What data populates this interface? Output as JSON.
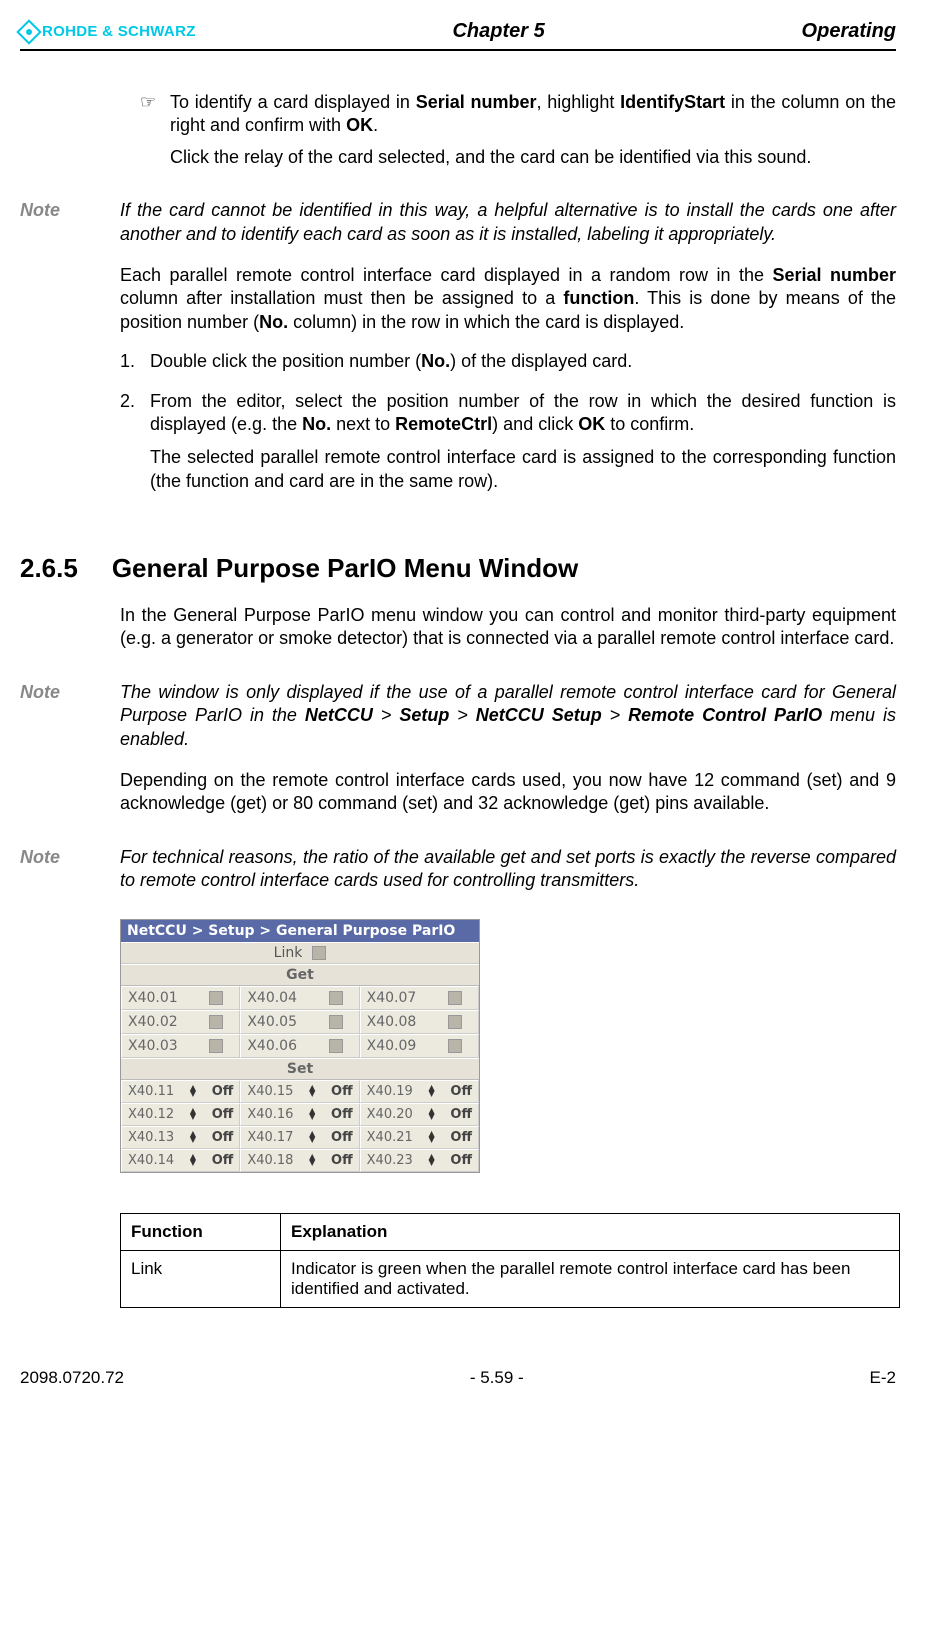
{
  "header": {
    "brand": "ROHDE & SCHWARZ",
    "chapter": "Chapter 5",
    "operating": "Operating"
  },
  "intro": {
    "bullet_pre": "To identify a card displayed in ",
    "serial_number": "Serial number",
    "bullet_mid": ", highlight ",
    "identify_start": "IdentifyStart",
    "bullet_post1": " in the column on the right and confirm with ",
    "ok": "OK",
    "bullet_end": ".",
    "sub": "Click the relay of the card selected, and the card can be identified via this sound."
  },
  "note1": {
    "label": "Note",
    "text": "If the card cannot be identified in this way, a helpful alternative is to install the cards one after another and to identify each card as soon as it is installed, labeling it appropriately."
  },
  "para1": {
    "pre": "Each parallel remote control interface card displayed in a random row in the ",
    "serial": "Serial number",
    "mid1": " column after installation must then be assigned to a ",
    "func": "function",
    "mid2": ". This is done by means of the position number (",
    "no": "No.",
    "end": " column) in the row in which the card is displayed."
  },
  "step1": {
    "num": "1.",
    "pre": "Double click the position number (",
    "no": "No.",
    "end": ") of the displayed card."
  },
  "step2": {
    "num": "2.",
    "pre": "From the editor, select the position number of the row in which the desired function is displayed (e.g. the ",
    "no": "No.",
    "mid": " next to ",
    "rc": "RemoteCtrl",
    "mid2": ") and click ",
    "ok": "OK",
    "end": " to confirm.",
    "sub": "The selected parallel remote control interface card is assigned to the corresponding function (the function and card are in the same row)."
  },
  "h2": {
    "num": "2.6.5",
    "title": "General Purpose ParIO Menu Window"
  },
  "para2": "In the General Purpose ParIO menu window you can control and monitor third-party equipment (e.g. a generator or smoke detector) that is connected via a parallel remote control interface card.",
  "note2": {
    "label": "Note",
    "pre": "The window is only displayed if the use of a parallel remote control interface card for General Purpose ParIO in the ",
    "path1": "NetCCU",
    "gt": " > ",
    "path2": "Setup",
    "path3": "NetCCU Setup",
    "path4": "Remote Control ParIO",
    "end": " menu is enabled."
  },
  "para3": "Depending on the remote control interface cards used, you now have 12 command (set) and 9 acknowledge (get) or 80 command (set) and 32 acknowledge (get) pins available.",
  "note3": {
    "label": "Note",
    "text": "For technical reasons, the ratio of the available get and set ports is exactly the reverse compared to remote control interface cards used for controlling transmitters."
  },
  "embed": {
    "title": "NetCCU  > Setup > General Purpose ParIO",
    "link": "Link",
    "get": "Get",
    "set": "Set",
    "off": "Off",
    "get_cells": [
      [
        "X40.01",
        "X40.04",
        "X40.07"
      ],
      [
        "X40.02",
        "X40.05",
        "X40.08"
      ],
      [
        "X40.03",
        "X40.06",
        "X40.09"
      ]
    ],
    "set_cells": [
      [
        "X40.11",
        "X40.15",
        "X40.19"
      ],
      [
        "X40.12",
        "X40.16",
        "X40.20"
      ],
      [
        "X40.13",
        "X40.17",
        "X40.21"
      ],
      [
        "X40.14",
        "X40.18",
        "X40.23"
      ]
    ]
  },
  "table": {
    "h1": "Function",
    "h2": "Explanation",
    "r1c1": "Link",
    "r1c2": "Indicator is green when the parallel remote control interface card has been identified and activated."
  },
  "footer": {
    "left": "2098.0720.72",
    "center": "- 5.59 -",
    "right": "E-2"
  }
}
